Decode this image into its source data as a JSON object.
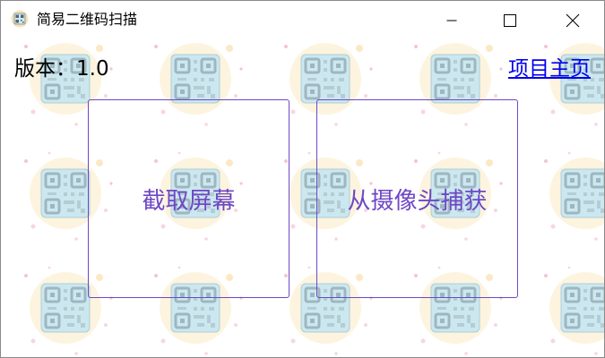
{
  "window": {
    "title": "简易二维码扫描",
    "controls": {
      "minimize_icon": "minimize-icon",
      "maximize_icon": "maximize-icon",
      "close_icon": "close-icon"
    }
  },
  "header": {
    "version_label": "版本：1.0",
    "homepage_link": "项目主页"
  },
  "actions": {
    "capture_screen": "截取屏幕",
    "capture_camera": "从摄像头捕获"
  },
  "colors": {
    "accent": "#6e47c6",
    "link": "#0000ee",
    "pattern_circle": "#fdf3dc",
    "pattern_qr": "#c9e7ef"
  }
}
